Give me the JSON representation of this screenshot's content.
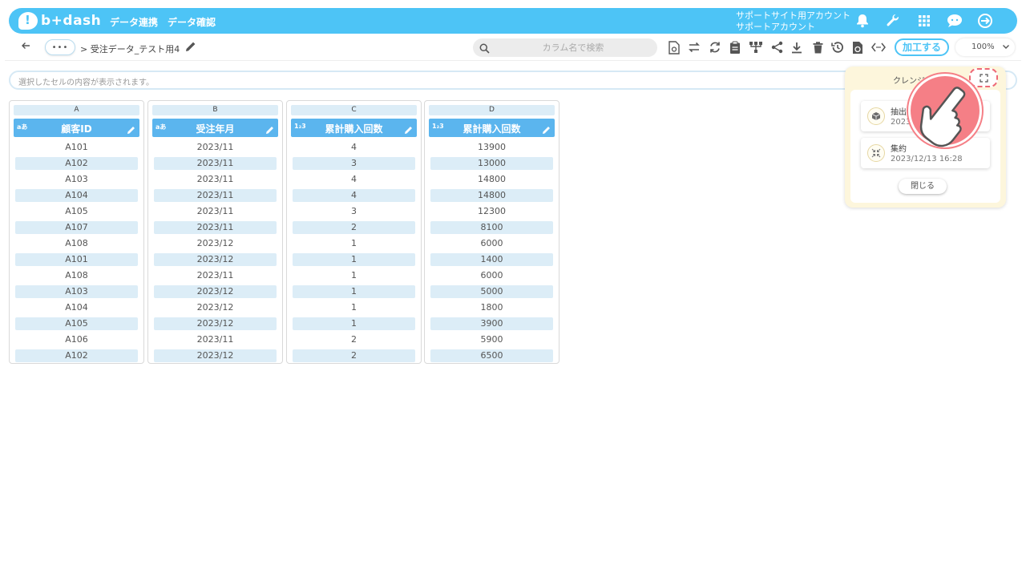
{
  "app": {
    "logo": "b+dash",
    "nav": [
      "データ連携",
      "データ確認"
    ],
    "account_line1": "サポートサイト用アカウント",
    "account_line2": "サポートアカウント"
  },
  "toolbar": {
    "more_label": "•••",
    "breadcrumb": "> 受注データ_テスト用4",
    "search_placeholder": "カラム名で検索",
    "process_label": "加工する",
    "zoom": "100%"
  },
  "cell_bar": {
    "placeholder": "選択したセルの内容が表示されます。"
  },
  "columns": [
    {
      "letter": "A",
      "type": "aあ",
      "name": "顧客ID",
      "cells": [
        "A101",
        "A102",
        "A103",
        "A104",
        "A105",
        "A107",
        "A108",
        "A101",
        "A108",
        "A103",
        "A104",
        "A105",
        "A106",
        "A102"
      ]
    },
    {
      "letter": "B",
      "type": "aあ",
      "name": "受注年月",
      "cells": [
        "2023/11",
        "2023/11",
        "2023/11",
        "2023/11",
        "2023/11",
        "2023/11",
        "2023/12",
        "2023/12",
        "2023/11",
        "2023/12",
        "2023/12",
        "2023/12",
        "2023/11",
        "2023/12"
      ]
    },
    {
      "letter": "C",
      "type": "1₂3",
      "name": "累計購入回数",
      "cells": [
        "4",
        "3",
        "4",
        "4",
        "3",
        "2",
        "1",
        "1",
        "1",
        "1",
        "1",
        "1",
        "2",
        "2"
      ]
    },
    {
      "letter": "D",
      "type": "1₂3",
      "name": "累計購入回数",
      "cells": [
        "13900",
        "13000",
        "14800",
        "14800",
        "12300",
        "8100",
        "6000",
        "1400",
        "6000",
        "5000",
        "1800",
        "3900",
        "5900",
        "6500"
      ]
    }
  ],
  "panel": {
    "title": "クレンジ",
    "items": [
      {
        "label": "抽出",
        "date": "2023"
      },
      {
        "label": "集約",
        "date": "2023/12/13 16:28"
      }
    ],
    "close_label": "閉じる"
  },
  "colors": {
    "brand": "#4dc4f6",
    "column_header": "#5bb5ee",
    "row_alt": "#dcedf7",
    "panel_bg": "#fdf6dc",
    "highlight": "#f57f86"
  }
}
